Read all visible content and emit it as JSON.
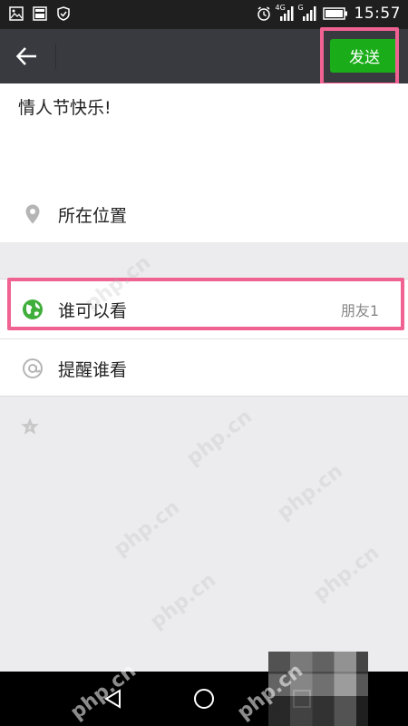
{
  "status_bar": {
    "time": "15:57",
    "network_primary": "4G",
    "network_secondary": "G",
    "icons": [
      "image-icon",
      "gallery-icon",
      "shield-icon",
      "alarm-icon",
      "signal-icon",
      "signal-icon",
      "battery-icon"
    ]
  },
  "app_bar": {
    "back_icon": "back-arrow-icon",
    "send_label": "发送",
    "send_color": "#1aad19"
  },
  "post": {
    "text": "情人节快乐!"
  },
  "location": {
    "label": "所在位置",
    "icon": "location-pin-icon"
  },
  "options": [
    {
      "label": "谁可以看",
      "value": "朋友1",
      "icon": "globe-icon"
    },
    {
      "label": "提醒谁看",
      "value": "",
      "icon": "at-icon"
    }
  ],
  "extra": {
    "icon": "star-icon"
  },
  "nav_bar": {
    "icons": [
      "back-triangle-icon",
      "home-circle-icon",
      "recent-square-icon"
    ]
  },
  "watermark": "php.cn",
  "colors": {
    "highlight": "#f06292",
    "accent_green": "#1aad19",
    "app_bar_bg": "#393a3f"
  }
}
